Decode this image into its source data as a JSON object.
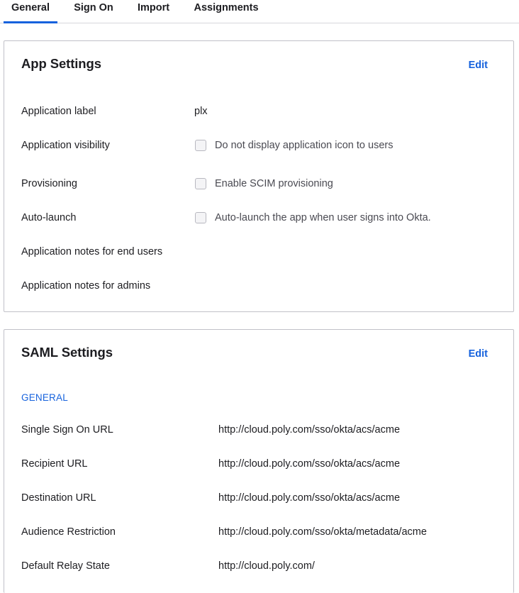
{
  "tabs": [
    {
      "label": "General",
      "active": true
    },
    {
      "label": "Sign On"
    },
    {
      "label": "Import"
    },
    {
      "label": "Assignments"
    }
  ],
  "app_settings": {
    "title": "App Settings",
    "edit_label": "Edit",
    "rows": [
      {
        "label": "Application label",
        "value": "plx"
      },
      {
        "label": "Application visibility",
        "checkbox_text": "Do not display application icon to users",
        "checked": false
      },
      {
        "label": "Provisioning",
        "checkbox_text": "Enable SCIM provisioning",
        "checked": false
      },
      {
        "label": "Auto-launch",
        "checkbox_text": "Auto-launch the app when user signs into Okta.",
        "checked": false
      },
      {
        "label": "Application notes for end users"
      },
      {
        "label": "Application notes for admins"
      }
    ]
  },
  "saml_settings": {
    "title": "SAML Settings",
    "edit_label": "Edit",
    "section": "GENERAL",
    "rows": [
      {
        "label": "Single Sign On URL",
        "value": "http://cloud.poly.com/sso/okta/acs/acme"
      },
      {
        "label": "Recipient URL",
        "value": "http://cloud.poly.com/sso/okta/acs/acme"
      },
      {
        "label": "Destination URL",
        "value": "http://cloud.poly.com/sso/okta/acs/acme"
      },
      {
        "label": "Audience Restriction",
        "value": "http://cloud.poly.com/sso/okta/metadata/acme"
      },
      {
        "label": "Default Relay State",
        "value": "http://cloud.poly.com/"
      }
    ]
  },
  "colors": {
    "accent": "#1662dd",
    "border": "#c1c1c8",
    "text": "#1d1d21"
  }
}
